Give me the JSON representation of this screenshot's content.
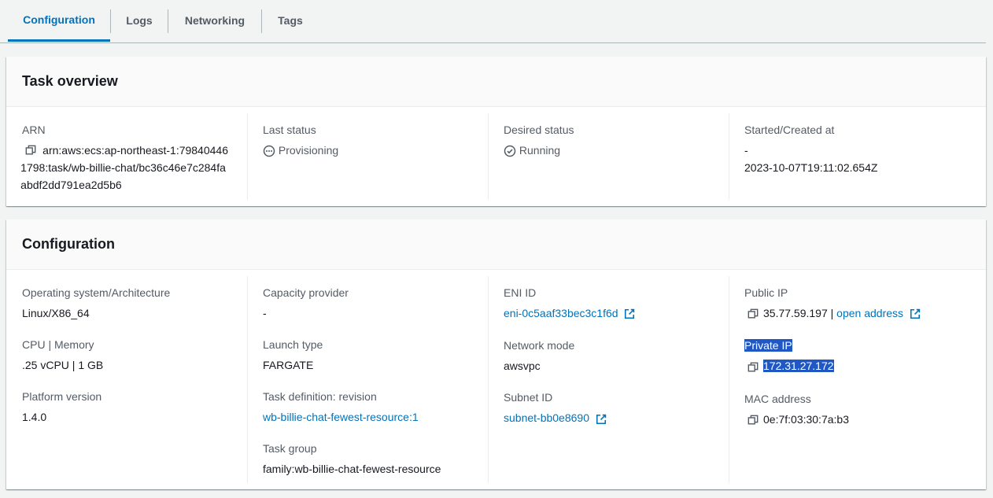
{
  "tabs": [
    {
      "label": "Configuration",
      "active": true
    },
    {
      "label": "Logs",
      "active": false
    },
    {
      "label": "Networking",
      "active": false
    },
    {
      "label": "Tags",
      "active": false
    }
  ],
  "overview": {
    "title": "Task overview",
    "arn_label": "ARN",
    "arn_value": "arn:aws:ecs:ap-northeast-1:798404461798:task/wb-billie-chat/bc36c46e7c284faabdf2dd791ea2d5b6",
    "last_status_label": "Last status",
    "last_status_value": "Provisioning",
    "desired_status_label": "Desired status",
    "desired_status_value": "Running",
    "started_label": "Started/Created at",
    "started_value": "-",
    "created_value": "2023-10-07T19:11:02.654Z"
  },
  "configuration": {
    "title": "Configuration",
    "os_label": "Operating system/Architecture",
    "os_value": "Linux/X86_64",
    "cpu_label": "CPU | Memory",
    "cpu_value": ".25 vCPU | 1 GB",
    "platform_label": "Platform version",
    "platform_value": "1.4.0",
    "capacity_label": "Capacity provider",
    "capacity_value": "-",
    "launch_label": "Launch type",
    "launch_value": "FARGATE",
    "taskdef_label": "Task definition: revision",
    "taskdef_value": "wb-billie-chat-fewest-resource:1",
    "taskgroup_label": "Task group",
    "taskgroup_value": "family:wb-billie-chat-fewest-resource",
    "eni_label": "ENI ID",
    "eni_value": "eni-0c5aaf33bec3c1f6d",
    "netmode_label": "Network mode",
    "netmode_value": "awsvpc",
    "subnet_label": "Subnet ID",
    "subnet_value": "subnet-bb0e8690",
    "public_ip_label": "Public IP",
    "public_ip_value": "35.77.59.197",
    "public_ip_sep": "|",
    "open_address_label": "open address",
    "private_ip_label": "Private IP",
    "private_ip_value": "172.31.27.172",
    "mac_label": "MAC address",
    "mac_value": "0e:7f:03:30:7a:b3"
  },
  "colors": {
    "accent": "#0073bb",
    "selection": "#1f57c5",
    "background": "#f2f3f3"
  }
}
